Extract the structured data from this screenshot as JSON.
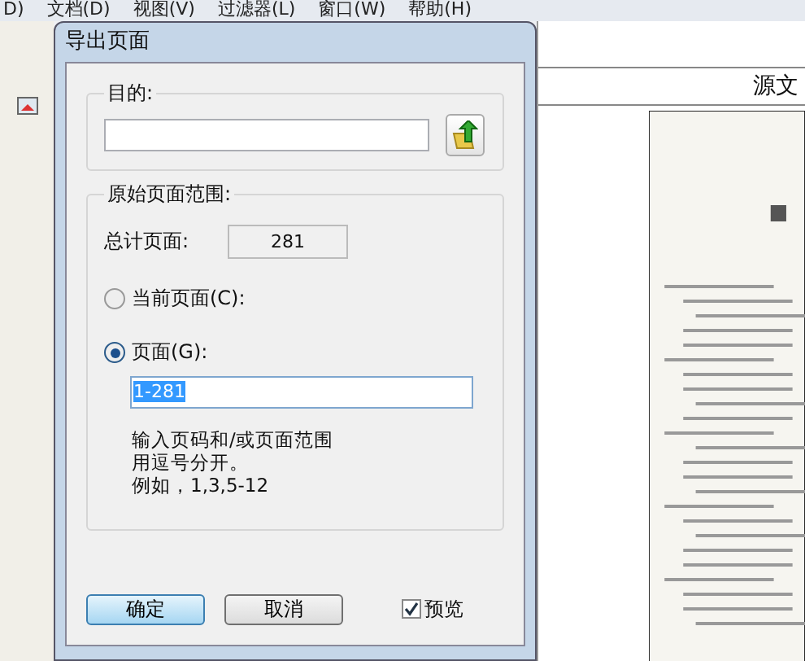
{
  "background_app": {
    "menu": [
      "D)",
      "文档(D)",
      "视图(V)",
      "过滤器(L)",
      "窗口(W)",
      "帮助(H)"
    ],
    "panel_title": "源文"
  },
  "dialog": {
    "title": "导出页面",
    "destination": {
      "label": "目的:"
    },
    "range": {
      "label": "原始页面范围:",
      "total_label": "总计页面:",
      "total_value": "281",
      "options": [
        {
          "label": "当前页面(C):",
          "selected": false
        },
        {
          "label": "页面(G):",
          "selected": true
        }
      ],
      "pages_value": "1-281",
      "hint": [
        "输入页码和/或页面范围",
        "用逗号分开。",
        "例如，1,3,5-12"
      ]
    },
    "buttons": [
      {
        "label": "确定",
        "default": true
      },
      {
        "label": "取消",
        "default": false
      }
    ],
    "preview": {
      "label": "预览",
      "checked": true
    }
  }
}
